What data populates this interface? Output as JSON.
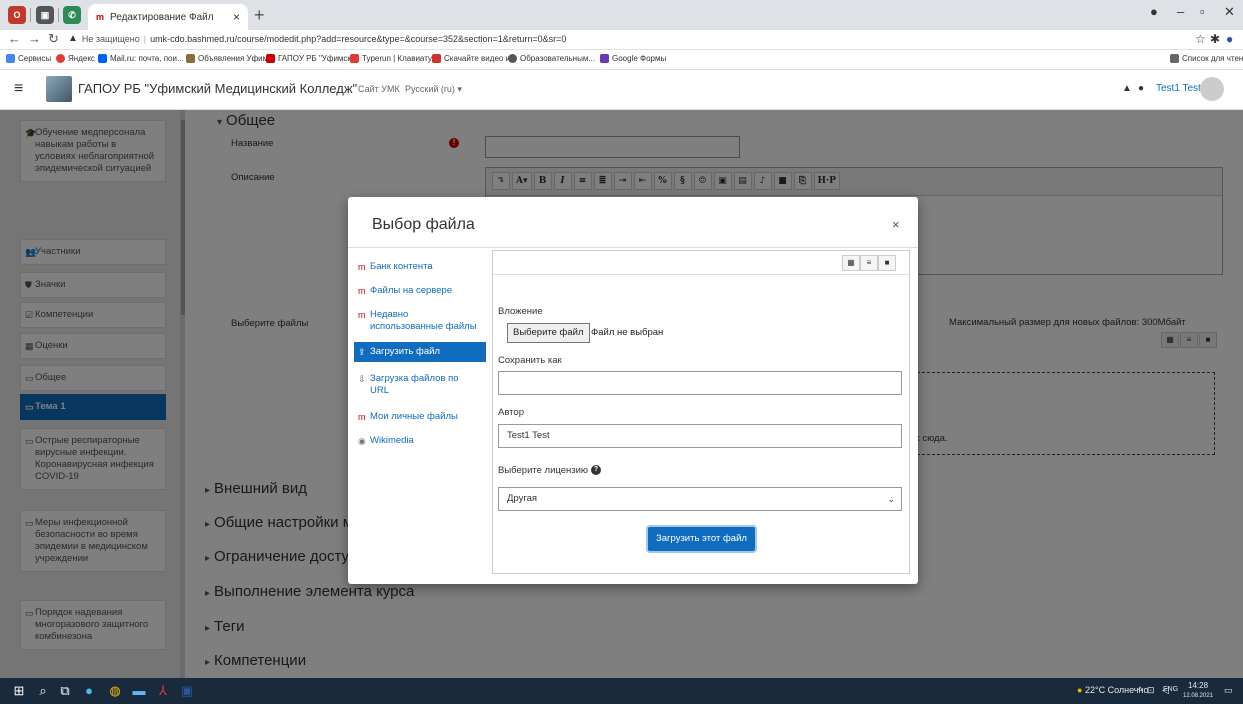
{
  "browser": {
    "tab_title": "Редактирование Файл",
    "tab_close": "×",
    "new_tab": "+",
    "security": "Не защищено",
    "url": "umk-cdo.bashmed.ru/course/modedit.php?add=resource&type=&course=352&section=1&return=0&sr=0",
    "bookmarks": [
      "Сервисы",
      "Яндекс",
      "Mail.ru: почта, пои...",
      "Объявления Уфим...",
      "ГАПОУ РБ \"Уфимск...",
      "Typerun | Клавиату...",
      "Скачайте видео и...",
      "Образовательным...",
      "Google Формы"
    ],
    "reading_list": "Список для чтени"
  },
  "navbar": {
    "site_name": "ГАПОУ РБ \"Уфимский Медицинский Колледж\"",
    "links": [
      "Сайт УМК",
      "Русский (ru) ▾"
    ],
    "user": "Test1 Test"
  },
  "drawer": {
    "items": [
      {
        "label": "Обучение медперсонала навыкам работы в условиях неблагоприятной эпидемической ситуацией",
        "icon": "graduation-cap-icon"
      },
      {
        "label": "Участники",
        "icon": "users-icon"
      },
      {
        "label": "Значки",
        "icon": "shield-icon"
      },
      {
        "label": "Компетенции",
        "icon": "checkbox-icon"
      },
      {
        "label": "Оценки",
        "icon": "table-icon"
      },
      {
        "label": "Общее",
        "icon": "folder-icon"
      },
      {
        "label": "Тема 1",
        "icon": "folder-icon"
      },
      {
        "label": "Острые респираторные вирусные инфекции. Коронавирусная инфекция COVID-19",
        "icon": "folder-icon"
      },
      {
        "label": "Меры инфекционной безопасности во время эпидемии в медицинском учреждении",
        "icon": "folder-icon"
      },
      {
        "label": "Порядок надевания многоразового защитного комбинезона",
        "icon": "folder-icon"
      }
    ]
  },
  "form": {
    "section_general": "Общее",
    "name_label": "Название",
    "description_label": "Описание",
    "files_label": "Выберите файлы",
    "max_size": "Максимальный размер для новых файлов: 300Мбайт",
    "drop_hint": "х сюда.",
    "sections": [
      "Внешний вид",
      "Общие настройки модуля",
      "Ограничение доступа",
      "Выполнение элемента курса",
      "Теги",
      "Компетенции"
    ]
  },
  "modal": {
    "title": "Выбор файла",
    "close": "×",
    "repos": [
      {
        "label": "Банк контента"
      },
      {
        "label": "Файлы на сервере"
      },
      {
        "label": "Недавно использованные файлы"
      },
      {
        "label": "Загрузить файл"
      },
      {
        "label": "Загрузка файлов по URL"
      },
      {
        "label": "Мои личные файлы"
      },
      {
        "label": "Wikimedia"
      }
    ],
    "attachment_label": "Вложение",
    "choose_file": "Выберите файл",
    "no_file": "Файл не выбран",
    "save_as_label": "Сохранить как",
    "save_as_value": "",
    "author_label": "Автор",
    "author_value": "Test1 Test",
    "license_label": "Выберите лицензию",
    "license_value": "Другая",
    "upload_button": "Загрузить этот файл"
  },
  "taskbar": {
    "weather": "22°C Солнечно",
    "lang": "ENG",
    "time": "14:28",
    "date": "12.08.2021"
  },
  "colors": {
    "accent": "#0f6cbf",
    "taskbar": "#1a2a3d"
  }
}
